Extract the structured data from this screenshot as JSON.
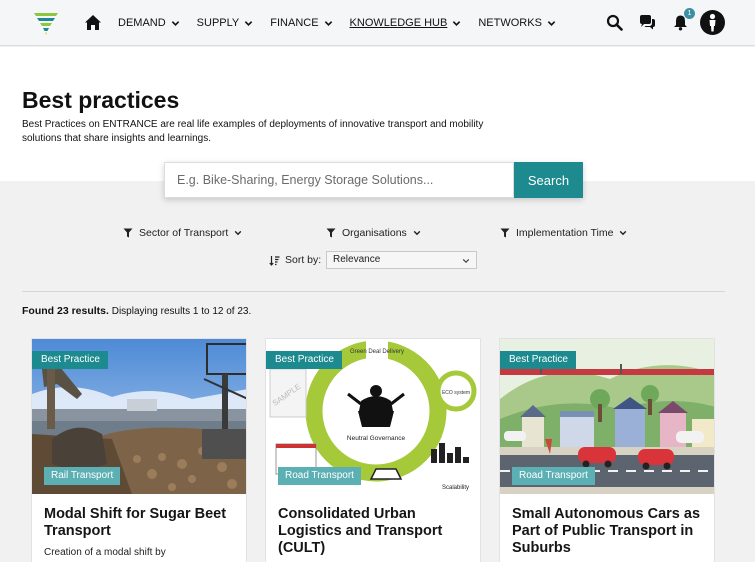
{
  "nav": {
    "menu": [
      {
        "label": "DEMAND",
        "active": false
      },
      {
        "label": "SUPPLY",
        "active": false
      },
      {
        "label": "FINANCE",
        "active": false
      },
      {
        "label": "KNOWLEDGE HUB",
        "active": true
      },
      {
        "label": "NETWORKS",
        "active": false
      }
    ],
    "notification_count": "1"
  },
  "hero": {
    "title": "Best practices",
    "description": "Best Practices on ENTRANCE are real life examples of deployments of innovative transport and mobility solutions that share insights and learnings."
  },
  "search": {
    "placeholder": "E.g. Bike-Sharing, Energy Storage Solutions...",
    "value": "",
    "button_label": "Search"
  },
  "filters": [
    {
      "label": "Sector of Transport"
    },
    {
      "label": "Organisations"
    },
    {
      "label": "Implementation Time"
    }
  ],
  "sort": {
    "label": "Sort by:",
    "selected": "Relevance"
  },
  "results": {
    "found": "Found 23 results.",
    "displaying": "Displaying results 1 to 12 of 23."
  },
  "cards": [
    {
      "badge": "Best Practice",
      "category": "Rail Transport",
      "title": "Modal Shift for Sugar Beet Transport",
      "description": "Creation of a modal shift by"
    },
    {
      "badge": "Best Practice",
      "category": "Road Transport",
      "title": "Consolidated Urban Logistics and Transport (CULT)",
      "description": "",
      "image_labels": {
        "top": "Green Deal Delivery",
        "center": "Neutral Governance",
        "right": "Scalability",
        "circle": "ECO system",
        "stamp": "SAMPLE"
      }
    },
    {
      "badge": "Best Practice",
      "category": "Road Transport",
      "title": "Small Autonomous Cars as Part of Public Transport in Suburbs",
      "description": ""
    }
  ],
  "colors": {
    "accent": "#1d8a8f",
    "tag_light": "#5cafb2",
    "nav_bg": "#f4f6f8",
    "logo_green": "#8dc63f",
    "logo_teal": "#1d8a8f"
  }
}
